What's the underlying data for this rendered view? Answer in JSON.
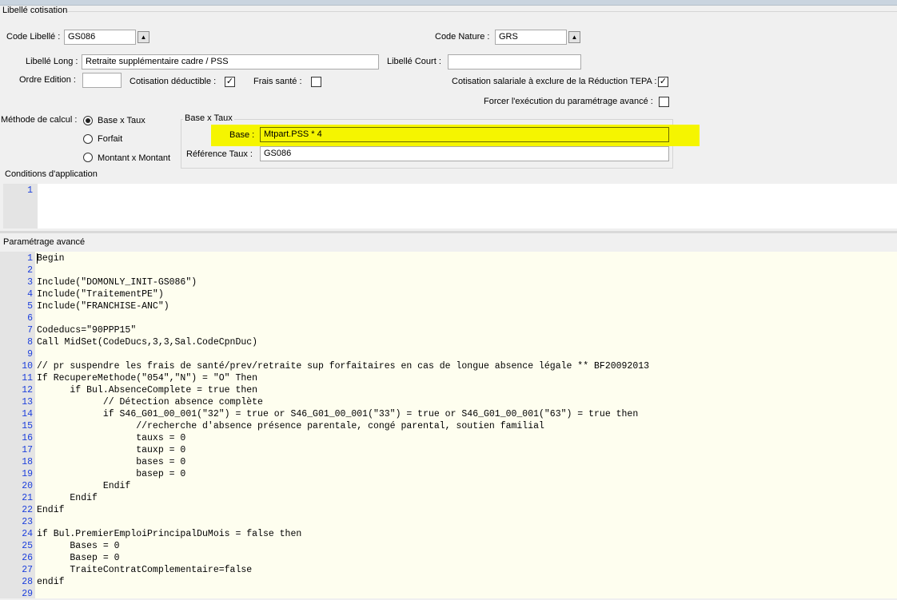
{
  "section_libelle": "Libellé cotisation",
  "code_libelle": {
    "label": "Code Libellé :",
    "value": "GS086"
  },
  "code_nature": {
    "label": "Code Nature :",
    "value": "GRS"
  },
  "libelle_long": {
    "label": "Libellé Long :",
    "value": "Retraite supplémentaire cadre / PSS"
  },
  "libelle_court": {
    "label": "Libellé Court :",
    "value": ""
  },
  "ordre_edition": {
    "label": "Ordre Edition :",
    "value": ""
  },
  "cotisation_deductible": {
    "label": "Cotisation déductible :",
    "checked": true
  },
  "frais_sante": {
    "label": "Frais santé :",
    "checked": false
  },
  "tepa": {
    "label": "Cotisation salariale à exclure de la Réduction TEPA :",
    "checked": true
  },
  "forcer": {
    "label": "Forcer l'exécution du paramétrage avancé :",
    "checked": false
  },
  "methode": {
    "label": "Méthode de calcul :",
    "options": [
      "Base x Taux",
      "Forfait",
      "Montant x Montant"
    ],
    "selected": "Base x Taux"
  },
  "base_taux": {
    "legend": "Base x Taux",
    "base_label": "Base :",
    "base_value": "Mtpart.PSS * 4",
    "ref_label": "Référence Taux :",
    "ref_value": "GS086"
  },
  "conditions": {
    "title": "Conditions d'application",
    "line_numbers": [
      "1"
    ]
  },
  "avance": {
    "title": "Paramétrage avancé",
    "lines": [
      "Begin",
      "",
      "Include(\"DOMONLY_INIT-GS086\")",
      "Include(\"TraitementPE\")",
      "Include(\"FRANCHISE-ANC\")",
      "",
      "Codeducs=\"90PPP15\"",
      "Call MidSet(CodeDucs,3,3,Sal.CodeCpnDuc)",
      "",
      "// pr suspendre les frais de santé/prev/retraite sup forfaitaires en cas de longue absence légale ** BF20092013",
      "If RecupereMethode(\"054\",\"N\") = \"O\" Then",
      "      if Bul.AbsenceComplete = true then",
      "            // Détection absence complète",
      "            if S46_G01_00_001(\"32\") = true or S46_G01_00_001(\"33\") = true or S46_G01_00_001(\"63\") = true then",
      "                  //recherche d'absence présence parentale, congé parental, soutien familial",
      "                  tauxs = 0",
      "                  tauxp = 0",
      "                  bases = 0",
      "                  basep = 0",
      "            Endif",
      "      Endif",
      "Endif",
      "",
      "if Bul.PremierEmploiPrincipalDuMois = false then",
      "      Bases = 0",
      "      Basep = 0",
      "      TraiteContratComplementaire=false",
      "endif",
      ""
    ]
  }
}
